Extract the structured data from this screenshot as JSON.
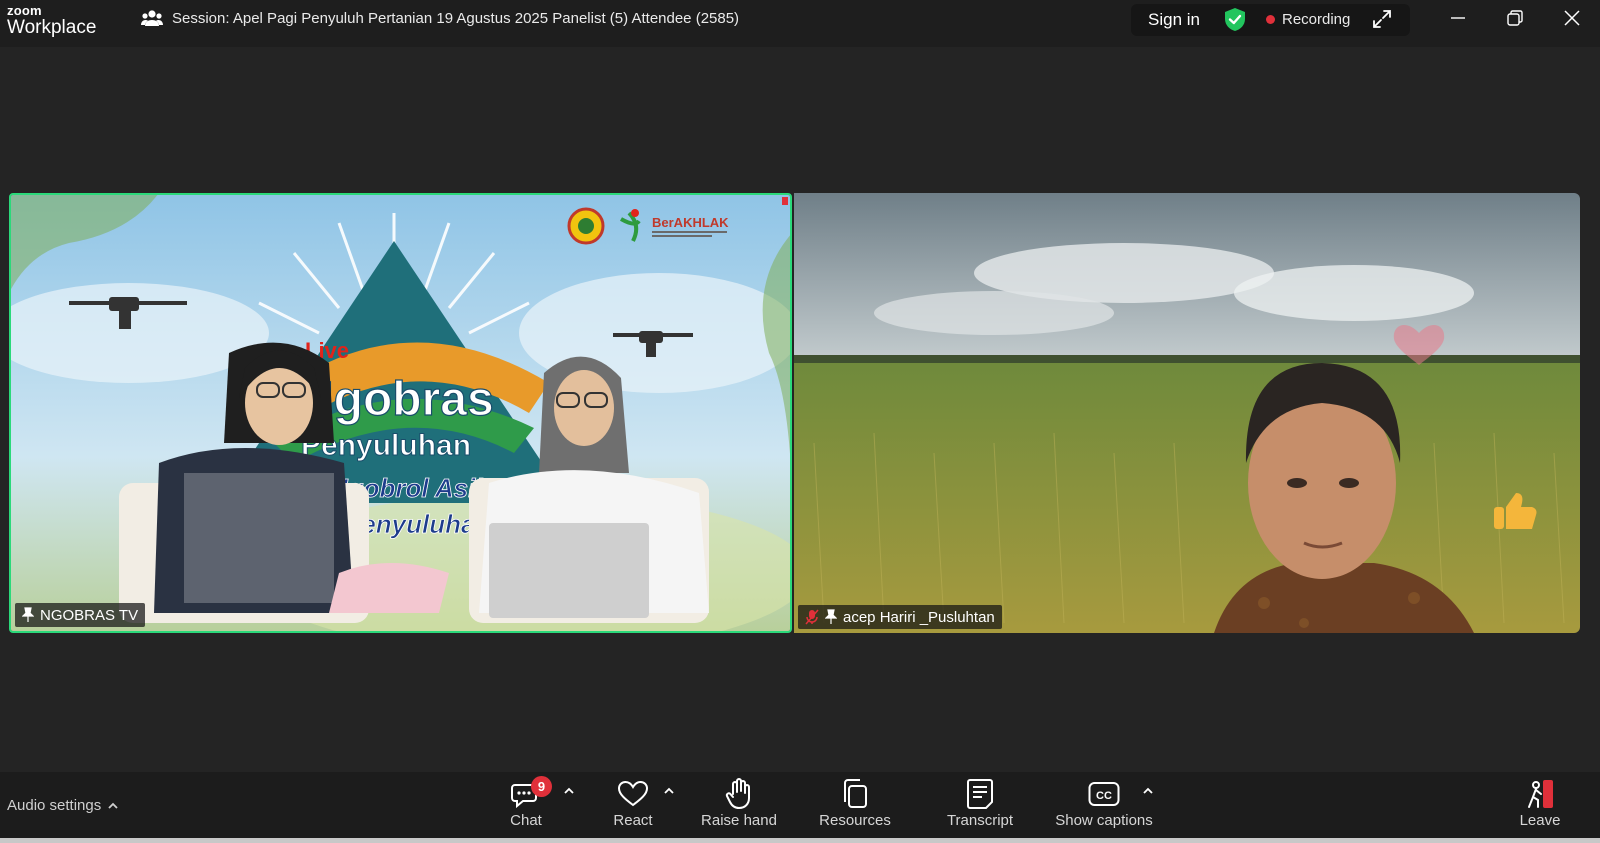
{
  "app": {
    "logo_top": "zoom",
    "logo_bottom": "Workplace",
    "session_title": "Session: Apel Pagi Penyuluh Pertanian 19 Agustus 2025 Panelist (5) Attendee (2585)",
    "sign_in": "Sign in",
    "recording": "Recording"
  },
  "tiles": [
    {
      "name": "NGOBRAS TV",
      "banner_live": "Live",
      "banner_title1": "Ngobras",
      "banner_title2": "Penyuluhan",
      "banner_tag1": "Ngobrol Asik",
      "banner_tag2": "Penyuluhan",
      "logo_text": "BerAKHLAK"
    },
    {
      "name": "acep Hariri _Pusluhtan"
    }
  ],
  "toolbar": {
    "audio_settings": "Audio settings",
    "chat": "Chat",
    "chat_badge": "9",
    "react": "React",
    "raise_hand": "Raise hand",
    "resources": "Resources",
    "transcript": "Transcript",
    "show_captions": "Show captions",
    "leave": "Leave"
  },
  "colors": {
    "active_speaker_border": "#2bd97a",
    "recording_dot": "#e0303a",
    "leave": "#e0303a",
    "shield": "#22c55e"
  }
}
